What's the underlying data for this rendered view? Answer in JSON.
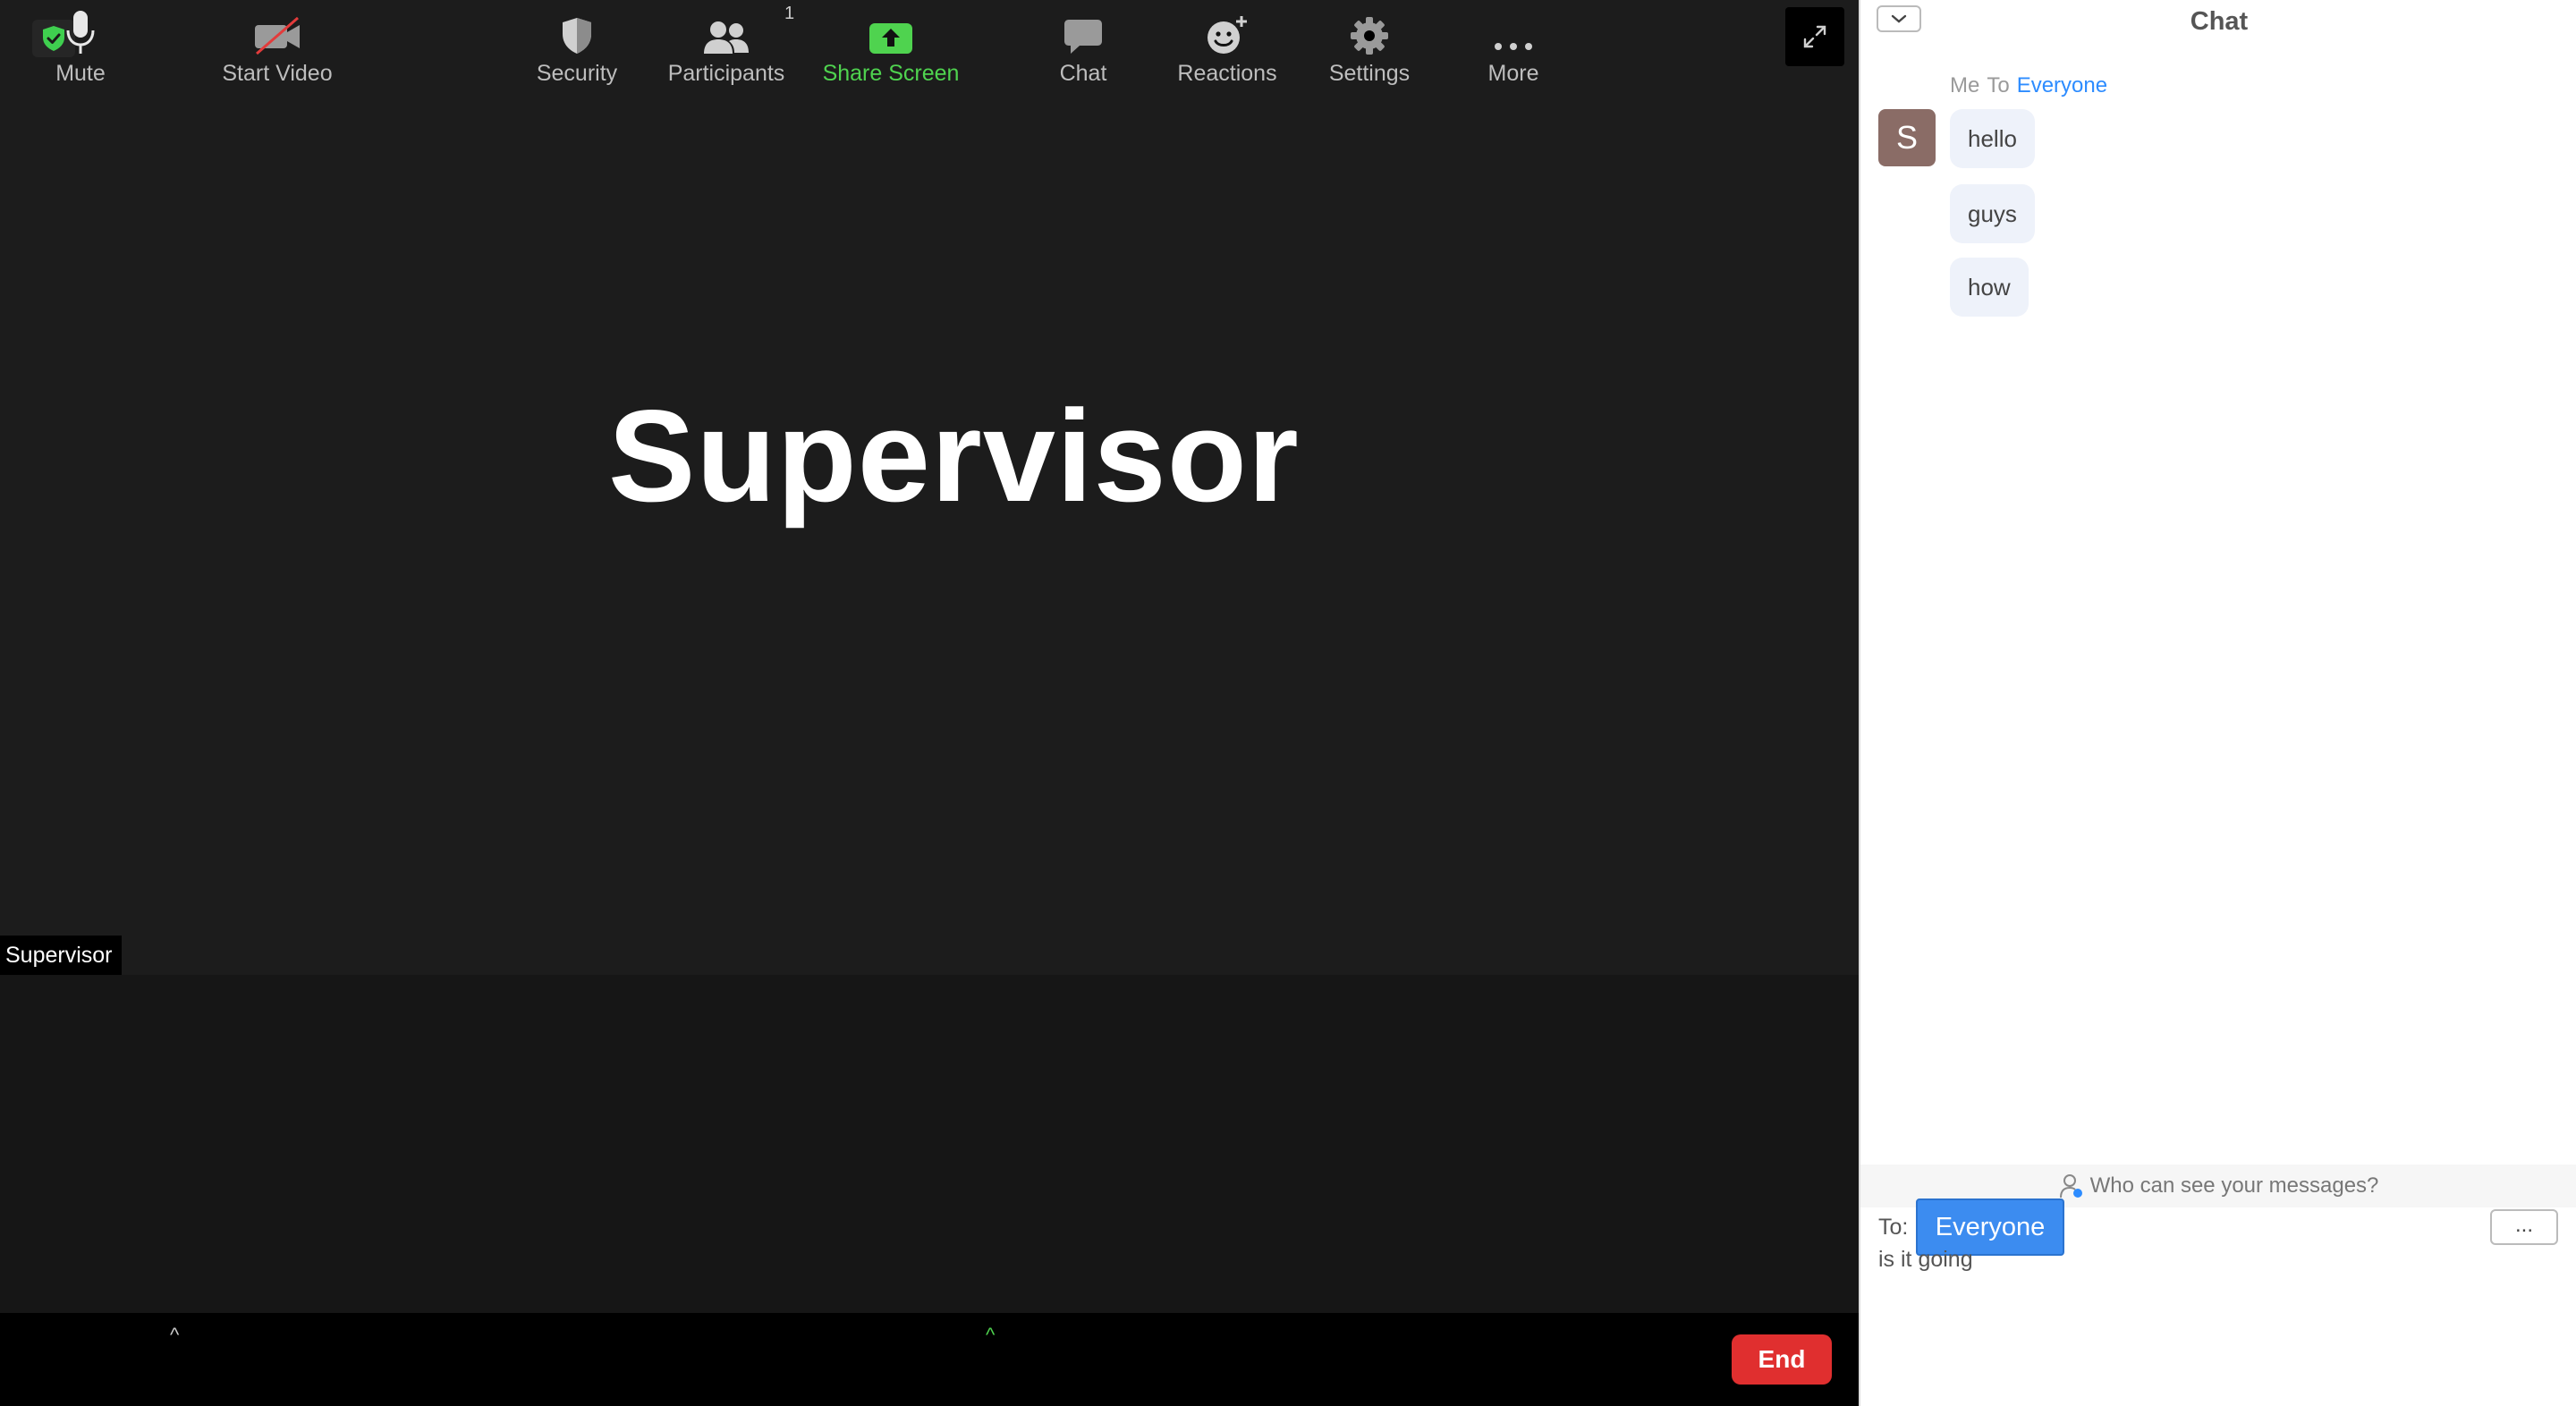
{
  "meeting": {
    "active_speaker": "Supervisor",
    "name_tag": "Supervisor"
  },
  "toolbar": {
    "mute_label": "Mute",
    "start_video_label": "Start Video",
    "security_label": "Security",
    "participants_label": "Participants",
    "participants_count": "1",
    "share_screen_label": "Share Screen",
    "chat_label": "Chat",
    "reactions_label": "Reactions",
    "settings_label": "Settings",
    "more_label": "More",
    "end_label": "End"
  },
  "chat": {
    "title": "Chat",
    "sender": "Me",
    "to_word": "To",
    "recipient": "Everyone",
    "avatar_initial": "S",
    "messages": [
      "hello",
      "guys",
      "how"
    ],
    "who_can_see": "Who can see your messages?",
    "to_label": "To:",
    "to_value": "Everyone",
    "more_button": "...",
    "input_value": "is it going"
  },
  "colors": {
    "accent": "#2d8cff",
    "share_green": "#4fd34f",
    "end_red": "#e02f2f",
    "shield_green": "#3fcf4f"
  },
  "icons": {
    "encryption": "shield-check-icon",
    "fullscreen": "expand-arrows-icon",
    "mute": "microphone-icon",
    "video": "video-off-icon",
    "security": "shield-icon",
    "participants": "people-icon",
    "share": "share-screen-icon",
    "chat": "speech-bubble-icon",
    "reactions": "emoji-plus-icon",
    "settings": "gear-icon",
    "more": "ellipsis-icon"
  }
}
